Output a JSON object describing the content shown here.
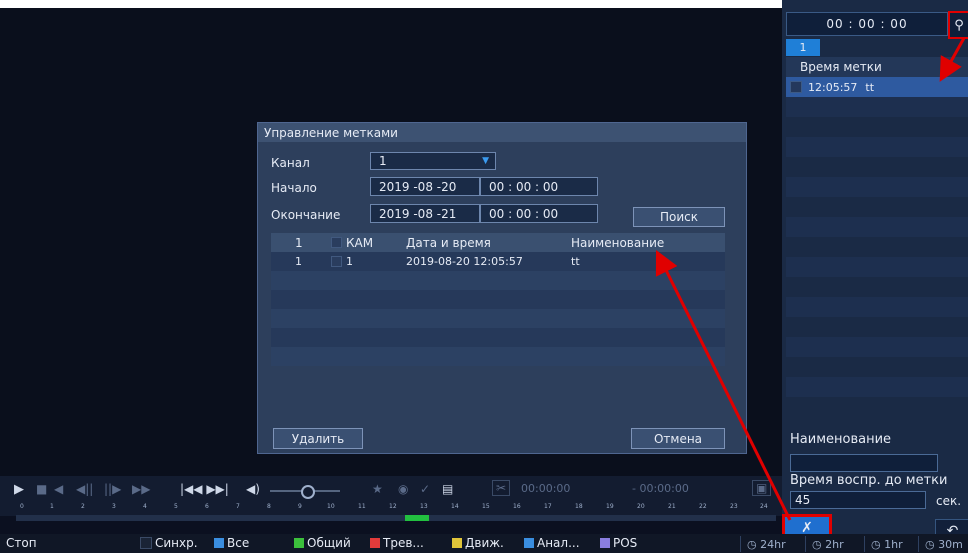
{
  "right_panel": {
    "time_value": "00 : 00 : 00",
    "tab_label": "1",
    "list_header": "Время метки",
    "marks": [
      {
        "time": "12:05:57",
        "name": "tt"
      }
    ],
    "name_label": "Наименование",
    "name_value": "",
    "duration_label": "Время воспр. до метки",
    "duration_value": "45",
    "duration_unit": "сек."
  },
  "dialog": {
    "title": "Управление метками",
    "channel_label": "Канал",
    "channel_value": "1",
    "start_label": "Начало",
    "start_date": "2019 -08 -20",
    "start_time": "00 : 00 : 00",
    "end_label": "Окончание",
    "end_date": "2019 -08 -21",
    "end_time": "00 : 00 : 00",
    "search_button": "Поиск",
    "table": {
      "headers": [
        "1",
        "КАМ",
        "Дата и время",
        "Наименование"
      ],
      "rows": [
        {
          "num": "1",
          "cam": "1",
          "datetime": "2019-08-20 12:05:57",
          "name": "tt"
        }
      ]
    },
    "delete_button": "Удалить",
    "cancel_button": "Отмена"
  },
  "player": {
    "time_start": "00:00:00",
    "time_end": "- 00:00:00",
    "timeline_ticks": [
      "0",
      "1",
      "2",
      "3",
      "4",
      "5",
      "6",
      "7",
      "8",
      "9",
      "10",
      "11",
      "12",
      "13",
      "14",
      "15",
      "16",
      "17",
      "18",
      "19",
      "20",
      "21",
      "22",
      "23",
      "24"
    ]
  },
  "status_bar": {
    "state": "Стоп",
    "sync_label": "Синхр.",
    "all_label": "Все",
    "filters": [
      {
        "label": "Общий",
        "color": "#3cc03c"
      },
      {
        "label": "Трев...",
        "color": "#e23b3b"
      },
      {
        "label": "Движ.",
        "color": "#e0c53a"
      },
      {
        "label": "Анал...",
        "color": "#3a8ee0"
      },
      {
        "label": "POS",
        "color": "#8a7ee0"
      }
    ],
    "zoom": [
      "24hr",
      "2hr",
      "1hr",
      "30m"
    ]
  },
  "colors": {
    "accent": "#1f7fd7",
    "highlight": "#e00000"
  }
}
